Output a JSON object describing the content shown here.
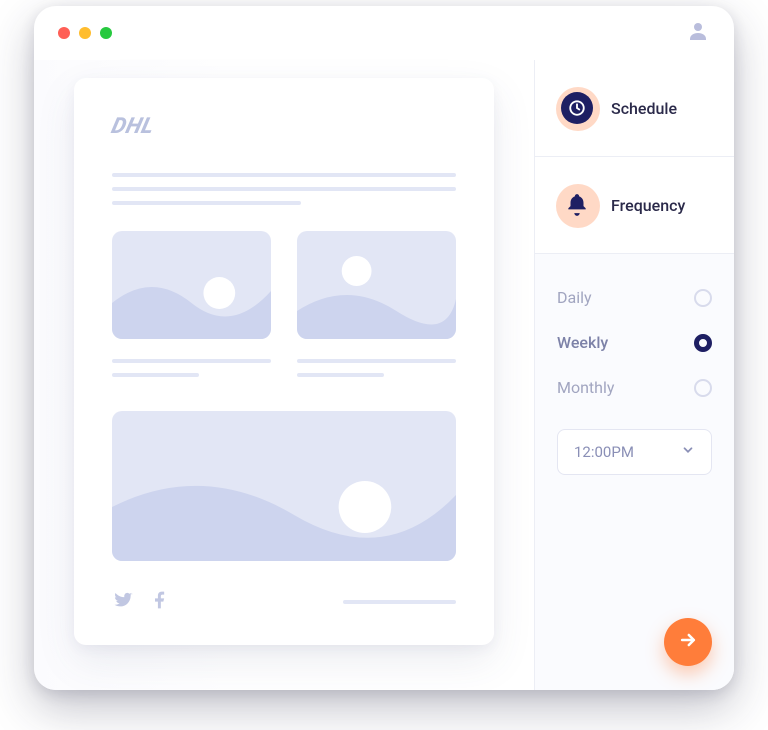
{
  "brand_logo_text": "DHL",
  "sidebar": {
    "schedule_label": "Schedule",
    "frequency_label": "Frequency"
  },
  "frequency": {
    "options": {
      "daily": "Daily",
      "weekly": "Weekly",
      "monthly": "Monthly"
    },
    "selected": "weekly",
    "time_value": "12:00PM"
  },
  "icons": {
    "avatar": "avatar-icon",
    "clock": "clock-icon",
    "bell": "bell-icon",
    "chevron_down": "chevron-down-icon",
    "arrow_right": "arrow-right-icon",
    "twitter": "twitter-icon",
    "facebook": "facebook-icon"
  }
}
